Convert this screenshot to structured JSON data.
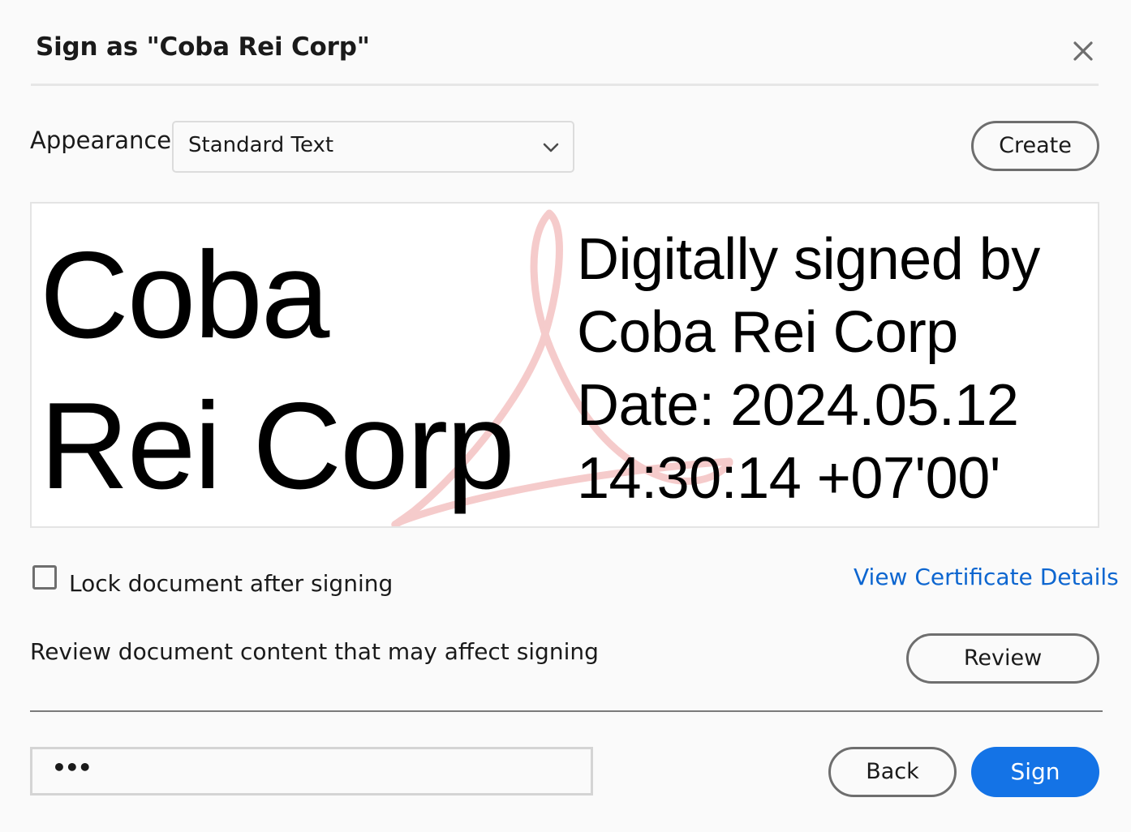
{
  "dialog": {
    "title": "Sign as \"Coba Rei Corp\"",
    "close_icon": "close-icon"
  },
  "appearance": {
    "label": "Appearance",
    "selected": "Standard Text",
    "create_label": "Create"
  },
  "preview": {
    "name_line1": "Coba",
    "name_line2": "Rei Corp",
    "details": [
      "Digitally signed by",
      "Coba Rei Corp",
      "Date: 2024.05.12",
      "14:30:14 +07'00'"
    ],
    "watermark_icon": "adobe-acrobat-logo-watermark",
    "watermark_color": "#f5c6c6"
  },
  "options": {
    "lock_label": "Lock document after signing",
    "lock_checked": false,
    "cert_link": "View Certificate Details",
    "review_text": "Review document content that may affect signing",
    "review_label": "Review"
  },
  "footer": {
    "more_text": "•••",
    "back_label": "Back",
    "sign_label": "Sign"
  },
  "colors": {
    "primary": "#1473e6",
    "link": "#0d66d0"
  }
}
